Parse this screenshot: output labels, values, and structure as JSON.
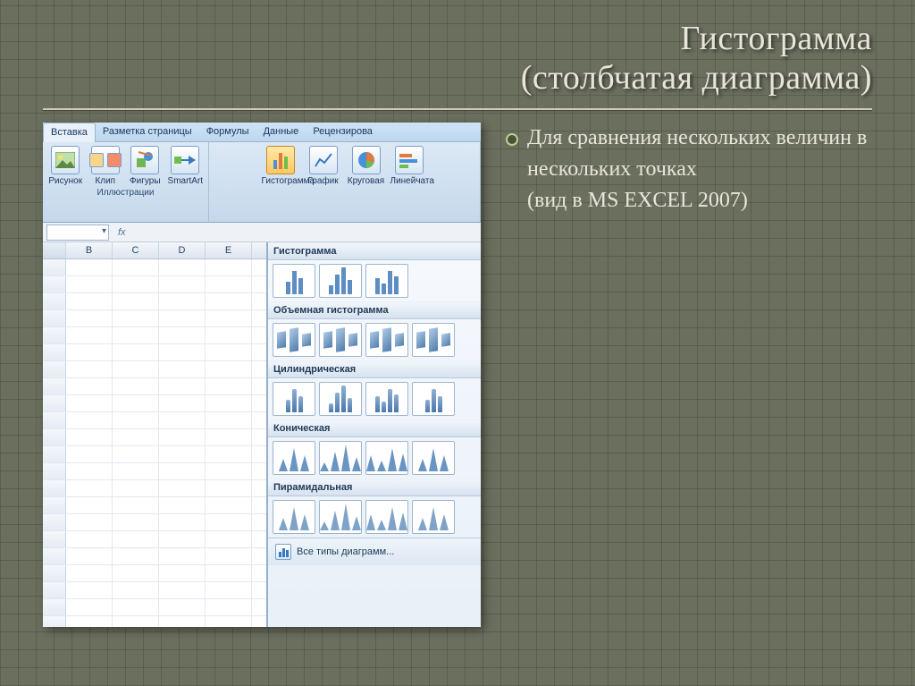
{
  "title_line1": "Гистограмма",
  "title_line2": "(столбчатая диаграмма)",
  "bullet_text": "Для сравнения нескольких величин в нескольких точках",
  "bullet_sub": "(вид в MS EXCEL 2007)",
  "ribbon": {
    "tabs": [
      "Вставка",
      "Разметка страницы",
      "Формулы",
      "Данные",
      "Рецензирова"
    ],
    "active_tab_index": 0,
    "group_illustrations_label": "Иллюстрации",
    "illus_buttons": [
      "Рисунок",
      "Клип",
      "Фигуры",
      "SmartArt"
    ],
    "chart_buttons": [
      "Гистограмма",
      "График",
      "Круговая",
      "Линейчата"
    ],
    "selected_chart_index": 0
  },
  "gallery": {
    "sections": [
      {
        "label": "Гистограмма",
        "rows": 1,
        "thumbs": 3,
        "kind": "bar"
      },
      {
        "label": "Объемная гистограмма",
        "rows": 1,
        "thumbs": 4,
        "kind": "d3"
      },
      {
        "label": "Цилиндрическая",
        "rows": 1,
        "thumbs": 4,
        "kind": "cyl"
      },
      {
        "label": "Коническая",
        "rows": 1,
        "thumbs": 4,
        "kind": "cone"
      },
      {
        "label": "Пирамидальная",
        "rows": 1,
        "thumbs": 4,
        "kind": "pyr"
      }
    ],
    "all_types_label": "Все типы диаграмм..."
  },
  "sheet": {
    "columns": [
      "",
      "B",
      "C",
      "D",
      "E"
    ],
    "rows": 22
  }
}
